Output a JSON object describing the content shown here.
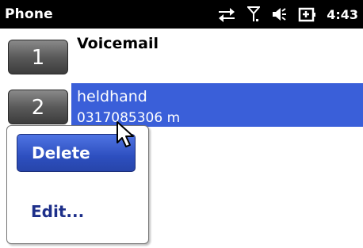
{
  "titlebar": {
    "title": "Phone",
    "clock": "4:43",
    "icons": [
      "data-connection-icon",
      "signal-icon",
      "speaker-icon",
      "battery-charging-icon"
    ]
  },
  "speed_dial": [
    {
      "key": "1",
      "name": "Voicemail",
      "detail": ""
    },
    {
      "key": "2",
      "name": "heldhand",
      "detail": "0317085306 m"
    }
  ],
  "context_menu": {
    "items": [
      "Delete",
      "Edit..."
    ],
    "selected": "Delete"
  },
  "colors": {
    "titlebar": "#000000",
    "selection": "#3a5fd9",
    "menu_highlight": "#2d4fbf"
  }
}
